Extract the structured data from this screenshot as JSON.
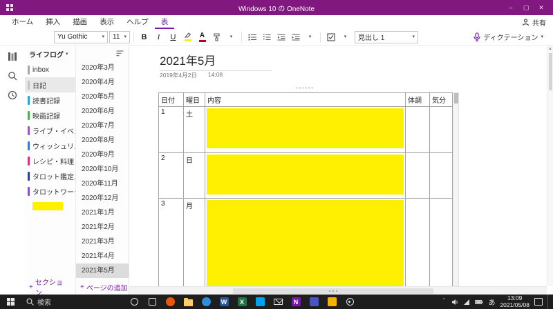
{
  "titlebar": {
    "title": "Windows 10 の OneNote",
    "controls": {
      "minimize": "–",
      "maximize": "▢",
      "close": "✕"
    }
  },
  "ribbon": {
    "tabs": [
      "ホーム",
      "挿入",
      "描画",
      "表示",
      "ヘルプ",
      "表"
    ],
    "active_tab": "表",
    "share_label": "共有",
    "font_name": "Yu Gothic",
    "font_size": "11",
    "bold_label": "B",
    "italic_label": "I",
    "underline_label": "U",
    "style_value": "見出し 1",
    "dictation_label": "ディクテーション"
  },
  "sidebar": {
    "notebook_name": "ライフログ",
    "sections": [
      {
        "label": "inbox",
        "bar": "#a6a6a6"
      },
      {
        "label": "日記",
        "bar": "#c3c3c3",
        "selected": true
      },
      {
        "label": "読書記録",
        "bar": "#29a3d8"
      },
      {
        "label": "映画記録",
        "bar": "#4caf50"
      },
      {
        "label": "ライブ・イベン...",
        "bar": "#9b59b6"
      },
      {
        "label": "ウィッシュリスト",
        "bar": "#3f74d1"
      },
      {
        "label": "レシピ・料理",
        "bar": "#d63384"
      },
      {
        "label": "タロット鑑定...",
        "bar": "#2c3e9f"
      },
      {
        "label": "タロットワーク",
        "bar": "#7e57c2"
      },
      {
        "label": "",
        "bar": "#ffef00",
        "highlight": true
      }
    ],
    "add_section_label": "セクション..."
  },
  "pages": {
    "items": [
      "2020年3月",
      "2020年4月",
      "2020年5月",
      "2020年6月",
      "2020年7月",
      "2020年8月",
      "2020年9月",
      "2020年10月",
      "2020年11月",
      "2020年12月",
      "2021年1月",
      "2021年2月",
      "2021年3月",
      "2021年4月",
      "2021年5月"
    ],
    "selected_index": 14,
    "add_page_label": "ページの追加"
  },
  "canvas": {
    "title": "2021年5月",
    "created_date": "2019年4月2日",
    "created_time": "14:08",
    "table": {
      "headers": [
        "日付",
        "曜日",
        "内容",
        "体調",
        "気分"
      ],
      "rows": [
        {
          "date": "1",
          "day": "土",
          "content_highlighted": true
        },
        {
          "date": "2",
          "day": "日",
          "content_highlighted": true
        },
        {
          "date": "3",
          "day": "月",
          "content_highlighted": true
        }
      ],
      "highlight_color": "#ffef00"
    }
  },
  "taskbar": {
    "search_label": "検索",
    "apps": [
      {
        "name": "cortana-icon",
        "kind": "ring"
      },
      {
        "name": "task-view-icon",
        "kind": "outline"
      },
      {
        "name": "browser-icon",
        "kind": "circle",
        "color": "#e8590c"
      },
      {
        "name": "file-explorer-icon",
        "kind": "folder"
      },
      {
        "name": "edge-icon",
        "kind": "circle",
        "color": "#2f8ed6"
      },
      {
        "name": "word-icon",
        "kind": "square",
        "color": "#2b579a",
        "glyph": "W"
      },
      {
        "name": "excel-icon",
        "kind": "square",
        "color": "#217346",
        "glyph": "X"
      },
      {
        "name": "store-icon",
        "kind": "square",
        "color": "#00a2ed"
      },
      {
        "name": "mail-icon",
        "kind": "envelope"
      },
      {
        "name": "onenote-icon",
        "kind": "square",
        "color": "#7719aa",
        "glyph": "N"
      },
      {
        "name": "teams-icon",
        "kind": "square",
        "color": "#4b53bc"
      },
      {
        "name": "photos-icon",
        "kind": "square",
        "color": "#f3b200"
      },
      {
        "name": "settings-icon",
        "kind": "gear"
      }
    ],
    "tray": {
      "ime": "あ",
      "time": "13:09",
      "date": "2021/05/08"
    }
  },
  "glyphs": {
    "chevron_down": "▾",
    "plus": "+",
    "caret_up": "＾",
    "scroll_up_arrow": "▲",
    "handle_dots": "••••••",
    "check": "✓"
  },
  "colors": {
    "accent": "#7719aa",
    "titlebar": "#80187f",
    "highlight": "#ffef00"
  }
}
